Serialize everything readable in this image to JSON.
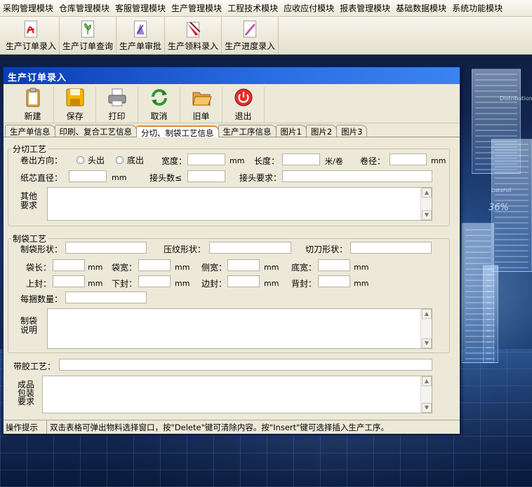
{
  "menu": [
    "采购管理模块",
    "仓库管理模块",
    "客服管理模块",
    "生产管理模块",
    "工程技术模块",
    "应收应付模块",
    "报表管理模块",
    "基础数据模块",
    "系统功能模块"
  ],
  "toolbar": [
    {
      "label": "生产订单录入",
      "icon": "pdf-document-icon"
    },
    {
      "label": "生产订单查询",
      "icon": "plant-document-icon"
    },
    {
      "label": "生产单审批",
      "icon": "purple-document-icon"
    },
    {
      "label": "生产领料录入",
      "icon": "red-pencil-document-icon"
    },
    {
      "label": "生产进度录入",
      "icon": "pink-pencil-document-icon"
    }
  ],
  "background": {
    "percent_text": "36%",
    "chart_text": "Distribution",
    "side_text": "DataFull"
  },
  "window": {
    "title": "生产订单录入",
    "toolbar": [
      {
        "label": "新建",
        "icon": "clipboard-icon"
      },
      {
        "label": "保存",
        "icon": "floppy-disk-icon"
      },
      {
        "label": "打印",
        "icon": "printer-icon"
      },
      {
        "label": "取消",
        "icon": "refresh-arrows-icon"
      },
      {
        "label": "旧单",
        "icon": "open-folder-icon"
      },
      {
        "label": "退出",
        "icon": "power-icon"
      }
    ],
    "tabs": [
      "生产单信息",
      "印刷、复合工艺信息",
      "分切、制袋工艺信息",
      "生产工序信息",
      "图片1",
      "图片2",
      "图片3"
    ],
    "active_tab": "分切、制袋工艺信息"
  },
  "cutting": {
    "legend": "分切工艺",
    "direction_label": "卷出方向：",
    "option_head": "头出",
    "option_bottom": "底出",
    "width_label": "宽度：",
    "width_unit": "mm",
    "length_label": "长度：",
    "length_unit": "米/卷",
    "roll_dia_label": "卷径：",
    "roll_dia_unit": "mm",
    "core_dia_label": "纸芯直径：",
    "core_dia_unit": "mm",
    "joints_label": "接头数≤",
    "joint_req_label": "接头要求：",
    "other_label_1": "其他",
    "other_label_2": "要求"
  },
  "bag": {
    "legend": "制袋工艺",
    "shape_label": "制袋形状：",
    "press_label": "压纹形状：",
    "knife_label": "切刀形状：",
    "len_label": "袋长：",
    "bag_width_label": "袋宽：",
    "side_width_label": "侧宽：",
    "bottom_width_label": "底宽：",
    "top_seal_label": "上封：",
    "bottom_seal_label": "下封：",
    "edge_seal_label": "边封：",
    "back_seal_label": "背封：",
    "unit": "mm",
    "bundle_label": "每捆数量：",
    "note_label_1": "制袋",
    "note_label_2": "说明"
  },
  "tape_label": "带胶工艺：",
  "pack_label_1": "成品",
  "pack_label_2": "包装",
  "pack_label_3": "要求",
  "status": {
    "title": "操作提示",
    "message": "双击表格可弹出物料选择窗口，按\"Delete\"键可清除内容。按\"Insert\"键可选择插入生产工序。"
  }
}
